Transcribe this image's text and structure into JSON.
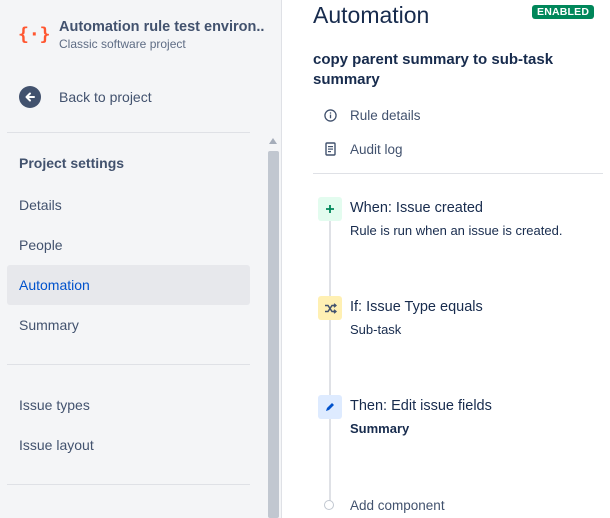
{
  "project": {
    "name": "Automation rule test environ...",
    "type": "Classic software project",
    "icon": "project-code-icon"
  },
  "sidebar": {
    "back_label": "Back to project",
    "section_title": "Project settings",
    "items": [
      {
        "label": "Details",
        "active": false
      },
      {
        "label": "People",
        "active": false
      },
      {
        "label": "Automation",
        "active": true
      },
      {
        "label": "Summary",
        "active": false
      }
    ],
    "items2": [
      {
        "label": "Issue types"
      },
      {
        "label": "Issue layout"
      }
    ]
  },
  "main": {
    "title": "Automation",
    "badge": "ENABLED",
    "rule_name": "copy parent summary to sub-task summary",
    "links": {
      "rule_details": "Rule details",
      "audit_log": "Audit log"
    },
    "components": [
      {
        "title": "When: Issue created",
        "subtitle": "Rule is run when an issue is created.",
        "icon": "plus-icon",
        "color": "#e3fcef",
        "icon_color": "#00875a"
      },
      {
        "title": "If: Issue Type equals",
        "subtitle": "Sub-task",
        "icon": "shuffle-icon",
        "color": "#fff0b3",
        "icon_color": "#42526e"
      },
      {
        "title": "Then: Edit issue fields",
        "subtitle": "Summary",
        "icon": "pencil-icon",
        "color": "#deebff",
        "icon_color": "#0052cc"
      }
    ],
    "add_component": "Add component"
  },
  "colors": {
    "accent": "#0052cc",
    "enabled": "#00875a",
    "project_icon": "#ff5630"
  }
}
